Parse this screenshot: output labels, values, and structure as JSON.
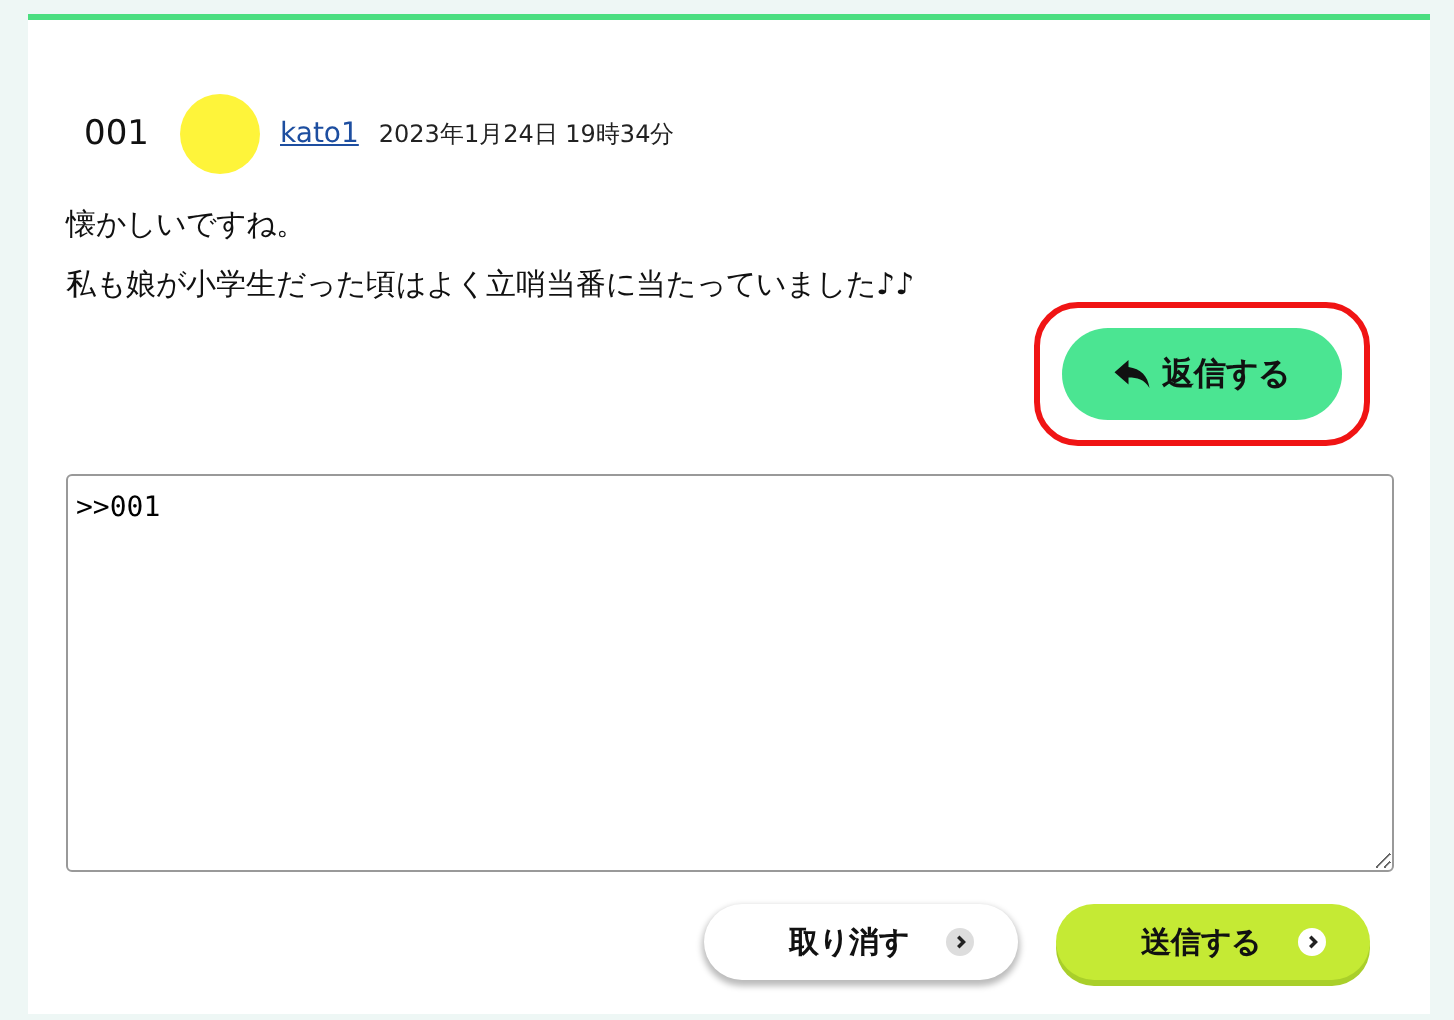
{
  "comment": {
    "number": "001",
    "author": "kato1",
    "date": "2023年1月24日 19時34分",
    "lines": [
      "懐かしいですね。",
      "私も娘が小学生だった頃はよく立哨当番に当たっていました♪♪"
    ],
    "reply_button": {
      "label": "返信する",
      "highlighted": true
    }
  },
  "reply_form": {
    "value": ">>001",
    "buttons": [
      {
        "label": "取り消す",
        "kind": "cancel"
      },
      {
        "label": "送信する",
        "kind": "submit"
      }
    ]
  }
}
